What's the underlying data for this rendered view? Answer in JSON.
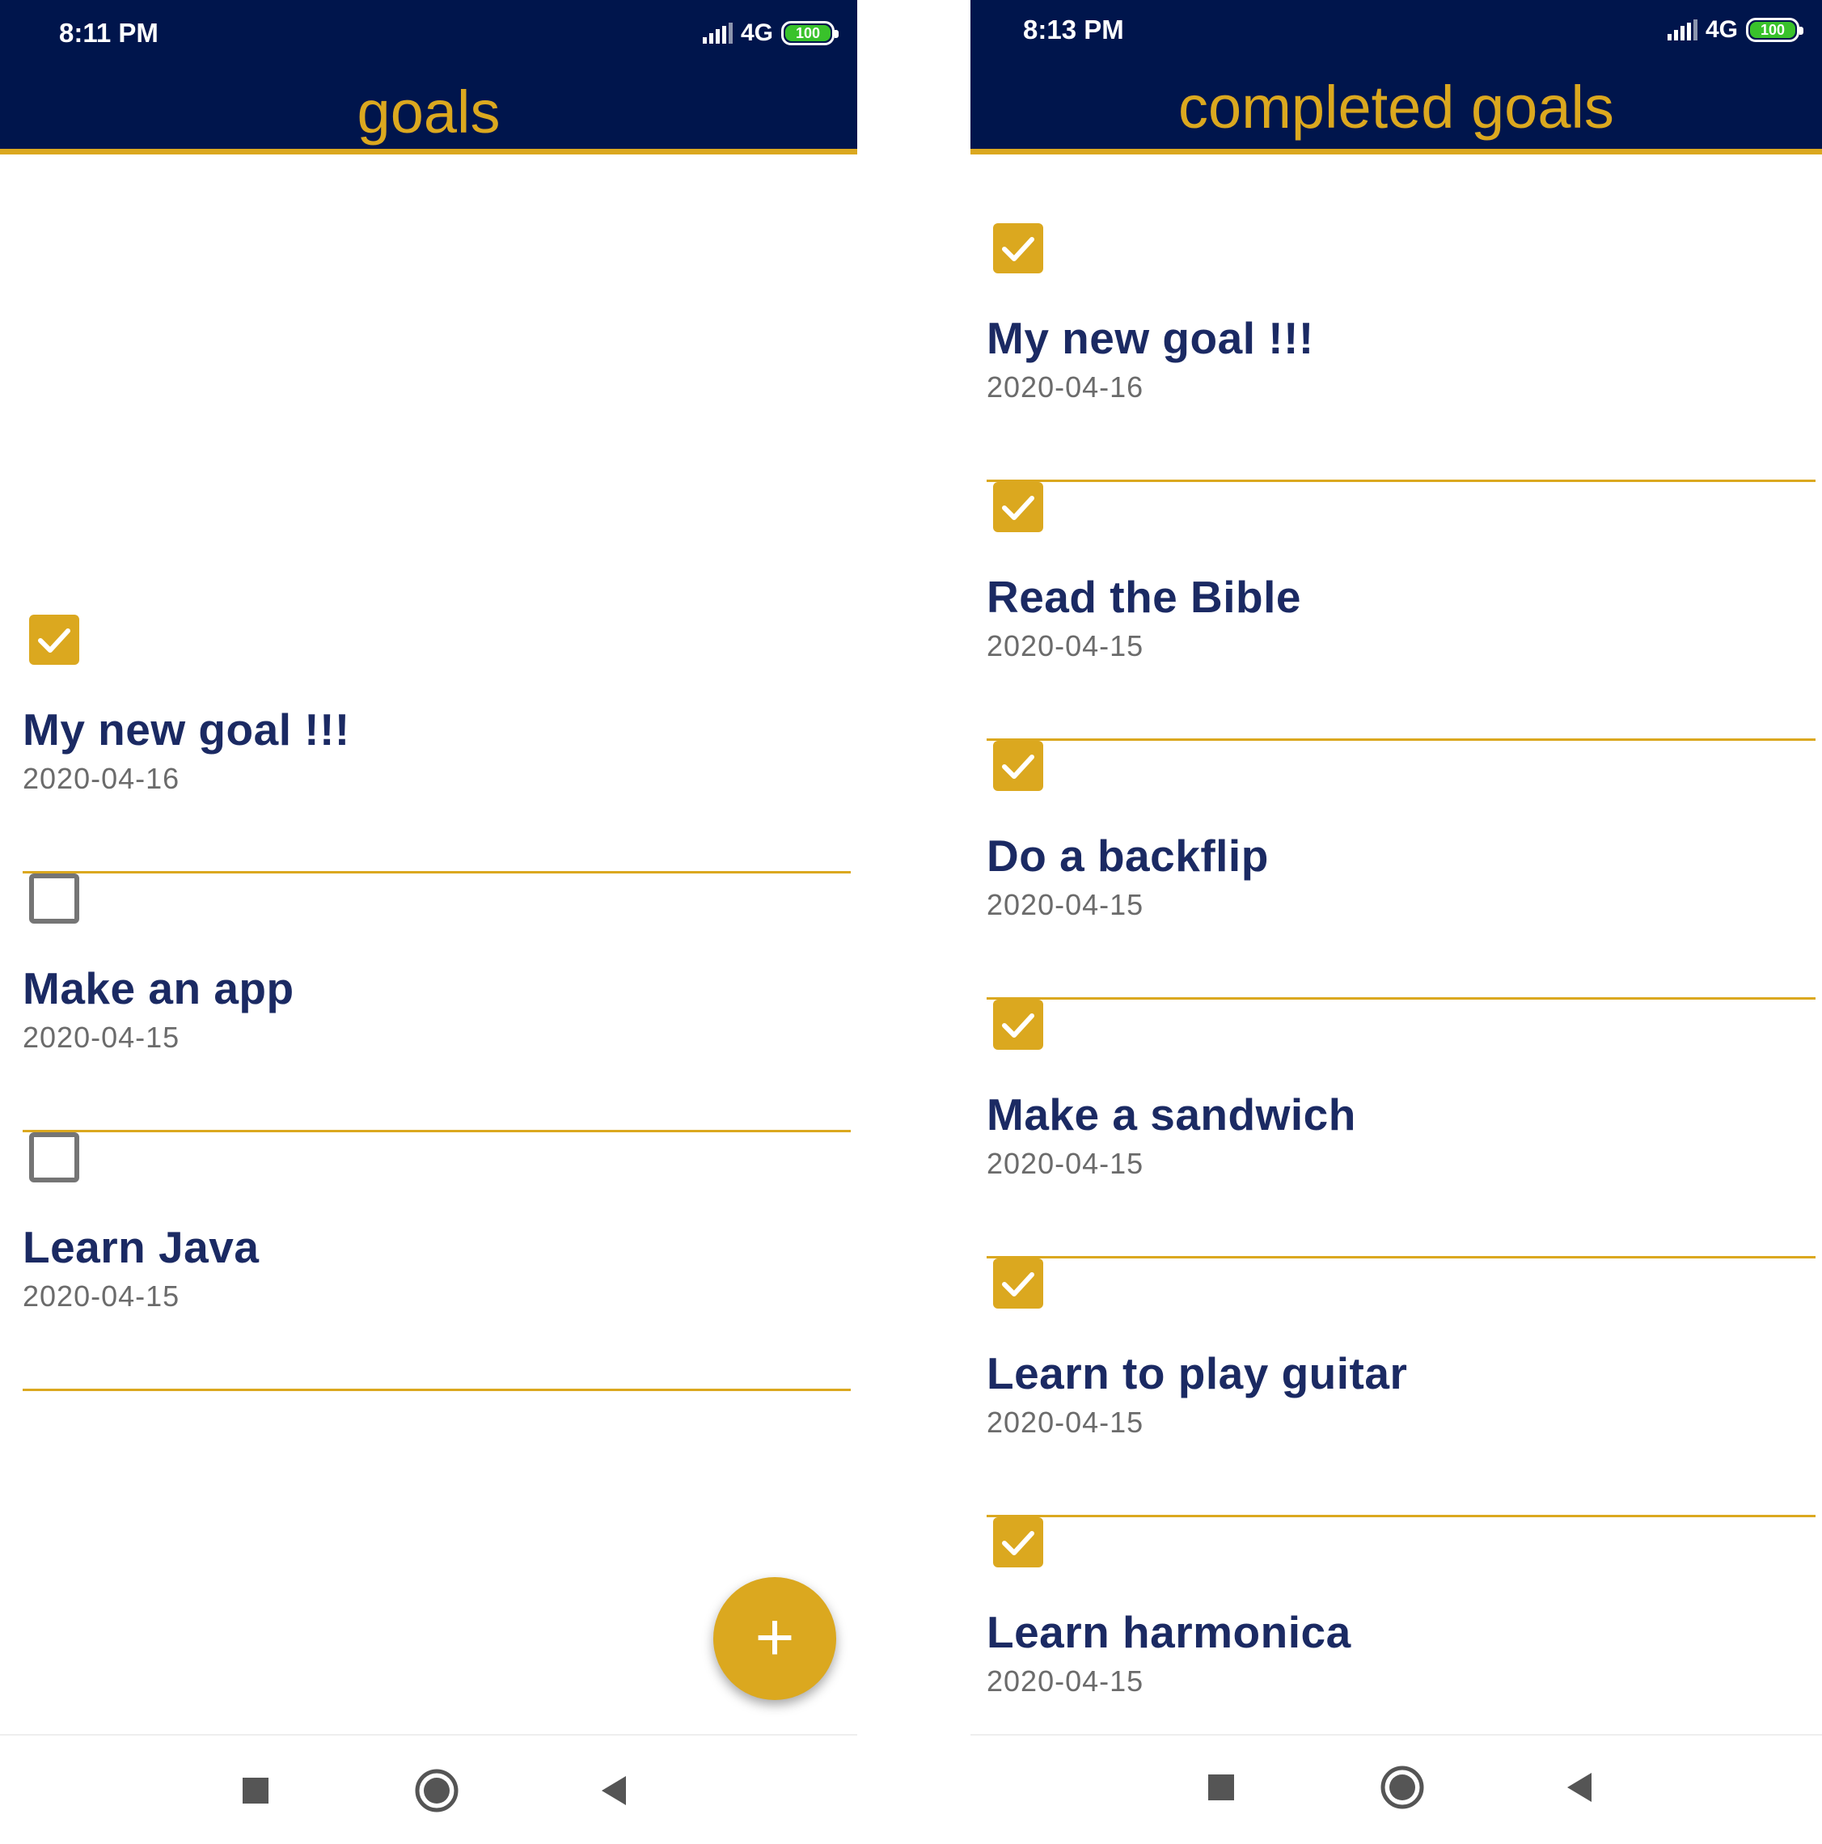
{
  "left_screen": {
    "status": {
      "time": "8:11 PM",
      "network": "4G",
      "battery": "100"
    },
    "title": "goals",
    "goals": [
      {
        "name": "My new goal !!!",
        "date": "2020-04-16",
        "checked": true
      },
      {
        "name": "Make an app",
        "date": "2020-04-15",
        "checked": false
      },
      {
        "name": "Learn Java",
        "date": "2020-04-15",
        "checked": false
      }
    ],
    "fab": {
      "label": "+",
      "icon": "plus-icon"
    }
  },
  "right_screen": {
    "status": {
      "time": "8:13 PM",
      "network": "4G",
      "battery": "100"
    },
    "title": "completed goals",
    "goals": [
      {
        "name": "My new goal !!!",
        "date": "2020-04-16",
        "checked": true
      },
      {
        "name": "Read the Bible",
        "date": "2020-04-15",
        "checked": true
      },
      {
        "name": "Do a backflip",
        "date": "2020-04-15",
        "checked": true
      },
      {
        "name": "Make a sandwich",
        "date": "2020-04-15",
        "checked": true
      },
      {
        "name": "Learn to play guitar",
        "date": "2020-04-15",
        "checked": true
      },
      {
        "name": "Learn harmonica",
        "date": "2020-04-15",
        "checked": true
      }
    ]
  },
  "navbar": {
    "icons": [
      "recents-square-icon",
      "home-circle-icon",
      "back-triangle-icon"
    ]
  },
  "colors": {
    "primary": "#00154c",
    "accent": "#dba81f",
    "goal_text": "#1b2a63",
    "date_text": "#6b6b6b"
  }
}
